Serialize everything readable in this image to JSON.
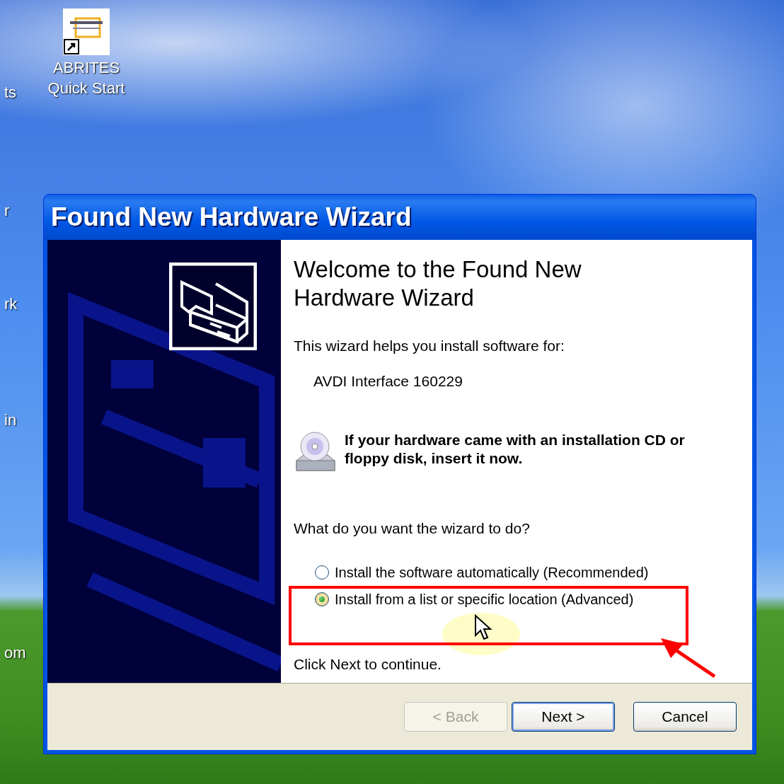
{
  "desktop": {
    "icons": [
      {
        "label": "ABRITES Quick Start"
      }
    ],
    "cut_labels": [
      "ts",
      "r",
      "rk",
      "in",
      "om"
    ]
  },
  "window": {
    "title": "Found New Hardware Wizard"
  },
  "content": {
    "heading": "Welcome to the Found New Hardware Wizard",
    "intro": "This wizard helps you install software for:",
    "device": "AVDI Interface 160229",
    "cd_notice": "If your hardware came with an installation CD or floppy disk, insert it now.",
    "question": "What do you want the wizard to do?",
    "options": [
      {
        "label": "Install the software automatically (Recommended)",
        "selected": false
      },
      {
        "label": "Install from a list or specific location (Advanced)",
        "selected": true
      }
    ],
    "footer": "Click Next to continue."
  },
  "buttons": [
    {
      "label": "< Back",
      "disabled": true,
      "default": false
    },
    {
      "label": "Next >",
      "disabled": false,
      "default": true
    },
    {
      "label": "Cancel",
      "disabled": false,
      "default": false
    }
  ]
}
